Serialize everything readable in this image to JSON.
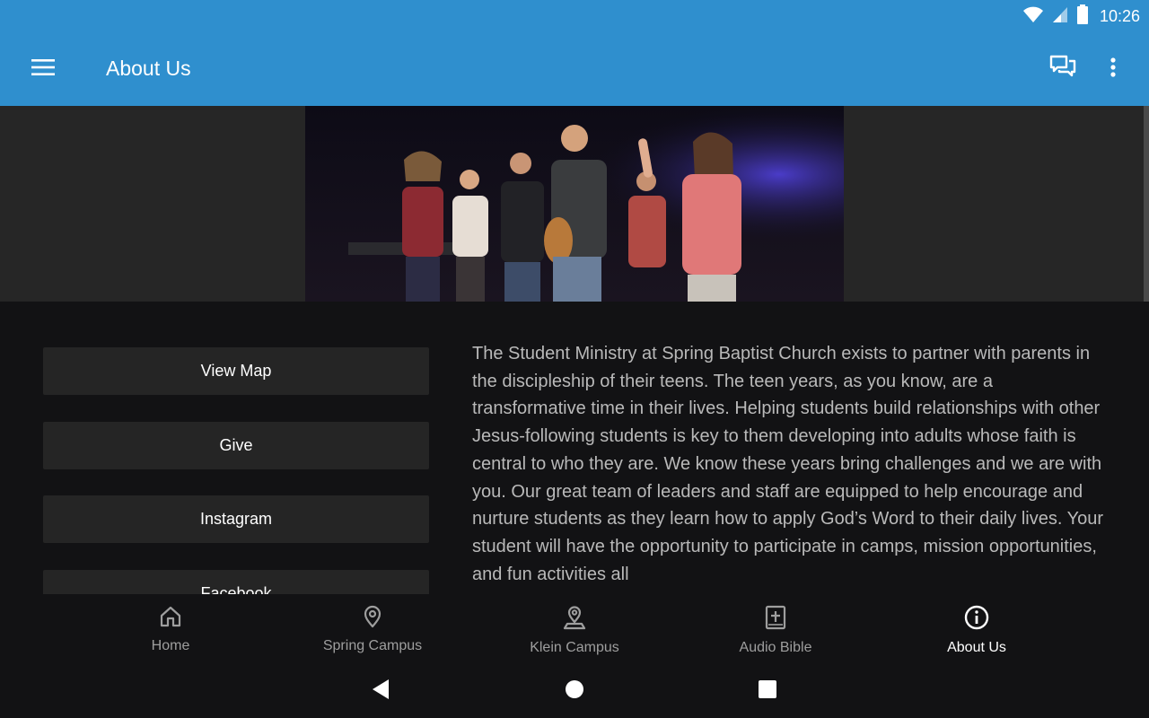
{
  "status_bar": {
    "time": "10:26"
  },
  "app_bar": {
    "title": "About Us"
  },
  "banner": {
    "image": "worship-band-photo"
  },
  "buttons": [
    {
      "label": "View Map"
    },
    {
      "label": "Give"
    },
    {
      "label": "Instagram"
    },
    {
      "label": "Facebook"
    }
  ],
  "about": {
    "text": "The Student Ministry at Spring Baptist Church exists to partner with parents in the discipleship of their teens. The teen years, as you know, are a transformative time in their lives. Helping students build relationships with other Jesus-following students is key to them developing into adults whose faith is central to who they are. We know these years bring challenges and we are with you. Our great team of leaders and staff are equipped to help encourage and nurture students as they learn how to apply God’s Word to their daily lives. Your student will have the opportunity to participate in camps, mission opportunities, and fun activities all"
  },
  "bottom_nav": {
    "items": [
      {
        "label": "Home",
        "icon": "home-icon"
      },
      {
        "label": "Spring Campus",
        "icon": "location-pin-icon"
      },
      {
        "label": "Klein Campus",
        "icon": "location-pin-base-icon"
      },
      {
        "label": "Audio Bible",
        "icon": "bible-icon"
      },
      {
        "label": "About Us",
        "icon": "info-icon",
        "active": true
      }
    ]
  },
  "colors": {
    "app_bar": "#2f8fce",
    "background": "#121214",
    "button": "#252525",
    "body_text": "#b9b9b9",
    "nav_inactive": "#9e9e9e",
    "nav_active": "#ffffff"
  }
}
